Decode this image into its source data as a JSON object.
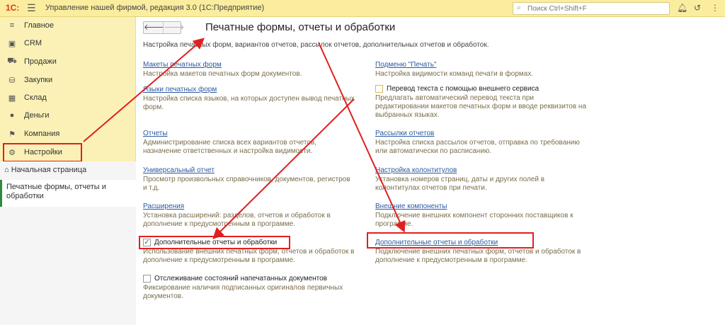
{
  "topbar": {
    "logo": "1С:",
    "app_title": "Управление нашей фирмой, редакция 3.0  (1С:Предприятие)",
    "search_placeholder": "Поиск Ctrl+Shift+F"
  },
  "sidebar": {
    "items": [
      {
        "label": "Главное",
        "icon": "menu-icon"
      },
      {
        "label": "CRM",
        "icon": "crm-icon"
      },
      {
        "label": "Продажи",
        "icon": "sales-icon"
      },
      {
        "label": "Закупки",
        "icon": "purchases-icon"
      },
      {
        "label": "Склад",
        "icon": "warehouse-icon"
      },
      {
        "label": "Деньги",
        "icon": "money-icon"
      },
      {
        "label": "Компания",
        "icon": "flag-icon"
      },
      {
        "label": "Настройки",
        "icon": "gear-icon"
      }
    ],
    "home": "Начальная страница",
    "open_window": "Печатные формы, отчеты и обработки"
  },
  "main": {
    "title": "Печатные формы, отчеты и обработки",
    "description": "Настройка печатных форм, вариантов отчетов, рассылок отчетов, дополнительных отчетов и обработок.",
    "left": [
      {
        "link": "Макеты печатных форм",
        "desc": "Настройка макетов печатных форм документов."
      },
      {
        "link": "Языки печатных форм",
        "desc": "Настройка списка языков, на которых доступен вывод печатных форм."
      },
      {
        "link": "Отчеты",
        "desc": "Администрирование списка всех вариантов отчетов, назначение ответственных и настройка видимости."
      },
      {
        "link": "Универсальный отчет",
        "desc": "Просмотр произвольных справочников, документов, регистров и т.д."
      },
      {
        "link": "Расширения",
        "desc": "Установка расширений: разделов, отчетов и обработок в дополнение к предусмотренным в программе."
      }
    ],
    "left_checkboxes": [
      {
        "label": "Дополнительные отчеты и обработки",
        "checked": true,
        "desc": "Использование внешних печатных форм, отчетов и обработок в дополнение к предусмотренным в программе."
      },
      {
        "label": "Отслеживание состояний напечатанных документов",
        "checked": false,
        "desc": "Фиксирование наличия подписанных оригиналов первичных документов."
      }
    ],
    "right": [
      {
        "link": "Подменю \"Печать\"",
        "desc": "Настройка видимости команд печати в формах."
      },
      {
        "link": "Рассылки отчетов",
        "desc": "Настройка списка рассылок отчетов, отправка по требованию или автоматически по расписанию."
      },
      {
        "link": "Настройка колонтитулов",
        "desc": "Установка номеров страниц, даты и других полей в колонтитулах отчетов при печати."
      },
      {
        "link": "Внешние компоненты",
        "desc": "Подключение внешних компонент сторонних поставщиков к программе."
      },
      {
        "link": "Дополнительные отчеты и обработки",
        "desc": "Подключение внешних печатных форм, отчетов и обработок в дополнение к предусмотренным в программе."
      }
    ],
    "right_checkbox": {
      "label": "Перевод текста с помощью внешнего сервиса",
      "checked": false,
      "desc": "Предлагать автоматический перевод текста при редактировании макетов печатных форм и вводе реквизитов на выбранных языках."
    }
  },
  "colors": {
    "accent": "#fbed9e",
    "sidebar": "#fbf1b6",
    "link": "#2c5aa0",
    "highlight": "#e02020"
  }
}
